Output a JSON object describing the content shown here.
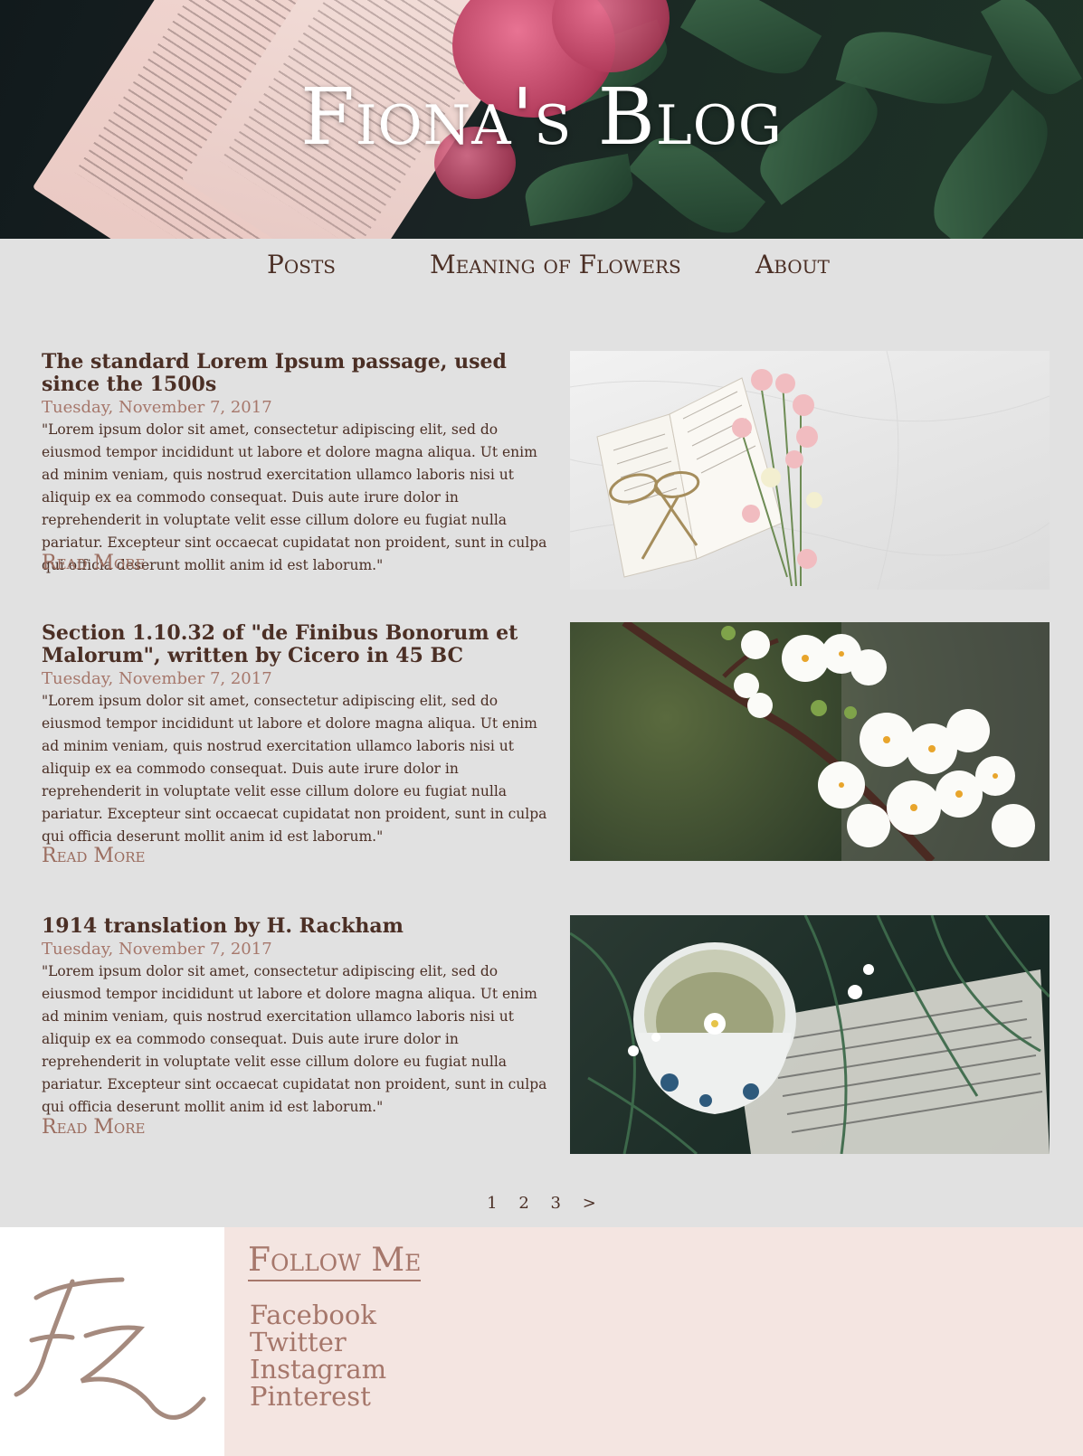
{
  "header": {
    "title": "Fiona's Blog"
  },
  "nav": {
    "items": [
      {
        "label": "Posts"
      },
      {
        "label": "Meaning of Flowers"
      },
      {
        "label": "About"
      }
    ]
  },
  "posts": [
    {
      "title": "The standard Lorem Ipsum passage, used since the 1500s",
      "date": "Tuesday, November 7, 2017",
      "body": "\"Lorem ipsum dolor sit amet, consectetur adipiscing elit, sed do eiusmod tempor incididunt ut labore et dolore magna aliqua. Ut enim ad minim veniam, quis nostrud exercitation ullamco laboris nisi ut aliquip ex ea commodo consequat. Duis aute irure dolor in reprehenderit in voluptate velit esse cillum dolore eu fugiat nulla pariatur. Excepteur sint occaecat cupidatat non proident, sunt in culpa qui officia deserunt mollit anim id est laborum.\"",
      "read_more": "Read More",
      "image": "book-flowers-photo"
    },
    {
      "title": "Section 1.10.32 of \"de Finibus Bonorum et Malorum\", written by Cicero in 45 BC",
      "date": "Tuesday, November 7, 2017",
      "body": "\"Lorem ipsum dolor sit amet, consectetur adipiscing elit, sed do eiusmod tempor incididunt ut labore et dolore magna aliqua. Ut enim ad minim veniam, quis nostrud exercitation ullamco laboris nisi ut aliquip ex ea commodo consequat. Duis aute irure dolor in reprehenderit in voluptate velit esse cillum dolore eu fugiat nulla pariatur. Excepteur sint occaecat cupidatat non proident, sunt in culpa qui officia deserunt mollit anim id est laborum.\"",
      "read_more": "Read More",
      "image": "blossom-branch-photo"
    },
    {
      "title": "1914 translation by H. Rackham",
      "date": "Tuesday, November 7, 2017",
      "body": "\"Lorem ipsum dolor sit amet, consectetur adipiscing elit, sed do eiusmod tempor incididunt ut labore et dolore magna aliqua. Ut enim ad minim veniam, quis nostrud exercitation ullamco laboris nisi ut aliquip ex ea commodo consequat. Duis aute irure dolor in reprehenderit in voluptate velit esse cillum dolore eu fugiat nulla pariatur. Excepteur sint occaecat cupidatat non proident, sunt in culpa qui officia deserunt mollit anim id est laborum.\"",
      "read_more": "Read More",
      "image": "tea-cup-photo"
    }
  ],
  "pagination": {
    "pages": [
      "1",
      "2",
      "3"
    ],
    "next": ">"
  },
  "footer": {
    "logo_text": "FZ",
    "follow_title": "Follow Me",
    "social_links": [
      {
        "label": "Facebook"
      },
      {
        "label": "Twitter"
      },
      {
        "label": "Instagram"
      },
      {
        "label": "Pinterest"
      }
    ]
  },
  "colors": {
    "background": "#e1e1e1",
    "text": "#4b2f25",
    "accent": "#a6776b",
    "footer_bg": "#f4e5e1"
  }
}
